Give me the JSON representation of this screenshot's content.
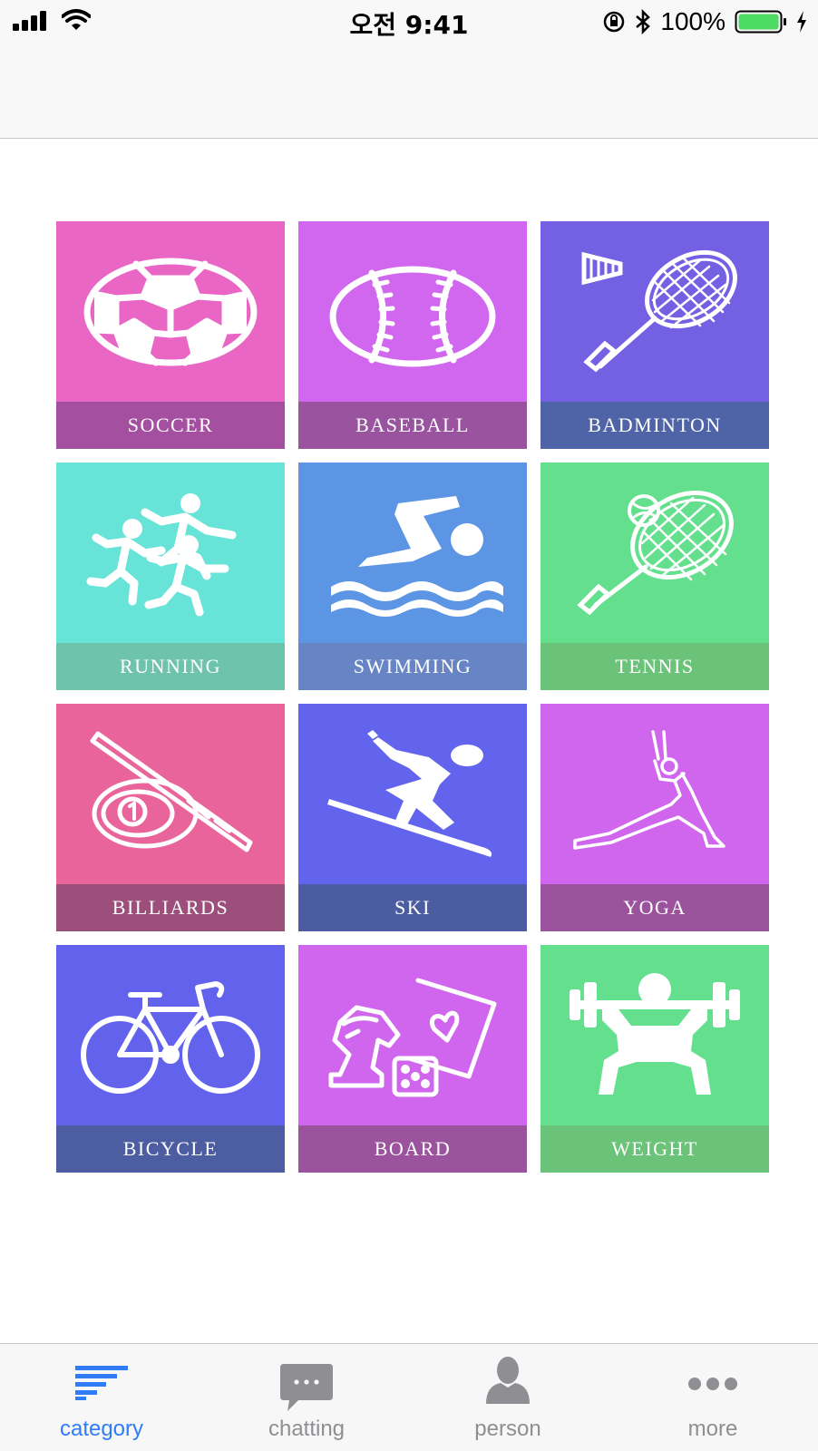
{
  "status_bar": {
    "time": "오전 9:41",
    "battery": "100%",
    "icons": [
      "signal-icon",
      "wifi-icon",
      "orientation-lock-icon",
      "bluetooth-icon",
      "battery-icon",
      "charging-icon"
    ]
  },
  "categories": [
    {
      "name": "SOCCER",
      "icon": "soccer-ball-icon",
      "color": "#e966c5",
      "band": "#a44fa0"
    },
    {
      "name": "BASEBALL",
      "icon": "baseball-icon",
      "color": "#d167ee",
      "band": "#9a549f"
    },
    {
      "name": "BADMINTON",
      "icon": "badminton-icon",
      "color": "#7460e3",
      "band": "#4f64a6"
    },
    {
      "name": "RUNNING",
      "icon": "runners-icon",
      "color": "#68e3d7",
      "band": "#6ec3ad"
    },
    {
      "name": "SWIMMING",
      "icon": "swimmer-icon",
      "color": "#5b95e4",
      "band": "#6784c5"
    },
    {
      "name": "TENNIS",
      "icon": "tennis-racket-icon",
      "color": "#64df8d",
      "band": "#6bc379"
    },
    {
      "name": "BILLIARDS",
      "icon": "billiards-icon",
      "color": "#e9649a",
      "band": "#9d4f7b"
    },
    {
      "name": "SKI",
      "icon": "skier-icon",
      "color": "#6264ed",
      "band": "#4b5da0"
    },
    {
      "name": "YOGA",
      "icon": "yoga-icon",
      "color": "#cf66ed",
      "band": "#9a539c"
    },
    {
      "name": "BICYCLE",
      "icon": "bicycle-icon",
      "color": "#6262ed",
      "band": "#4d5da1"
    },
    {
      "name": "BOARD",
      "icon": "board-game-icon",
      "color": "#cf66ed",
      "band": "#9a539c"
    },
    {
      "name": "WEIGHT",
      "icon": "weightlifter-icon",
      "color": "#64df8d",
      "band": "#6bc379"
    }
  ],
  "tab_bar": {
    "active_color": "#2f7cf6",
    "inactive_color": "#8e8e93",
    "tabs": [
      {
        "label": "category",
        "icon": "category-bars-icon",
        "active": true
      },
      {
        "label": "chatting",
        "icon": "chat-bubble-icon",
        "active": false
      },
      {
        "label": "person",
        "icon": "person-icon",
        "active": false
      },
      {
        "label": "more",
        "icon": "more-dots-icon",
        "active": false
      }
    ]
  }
}
